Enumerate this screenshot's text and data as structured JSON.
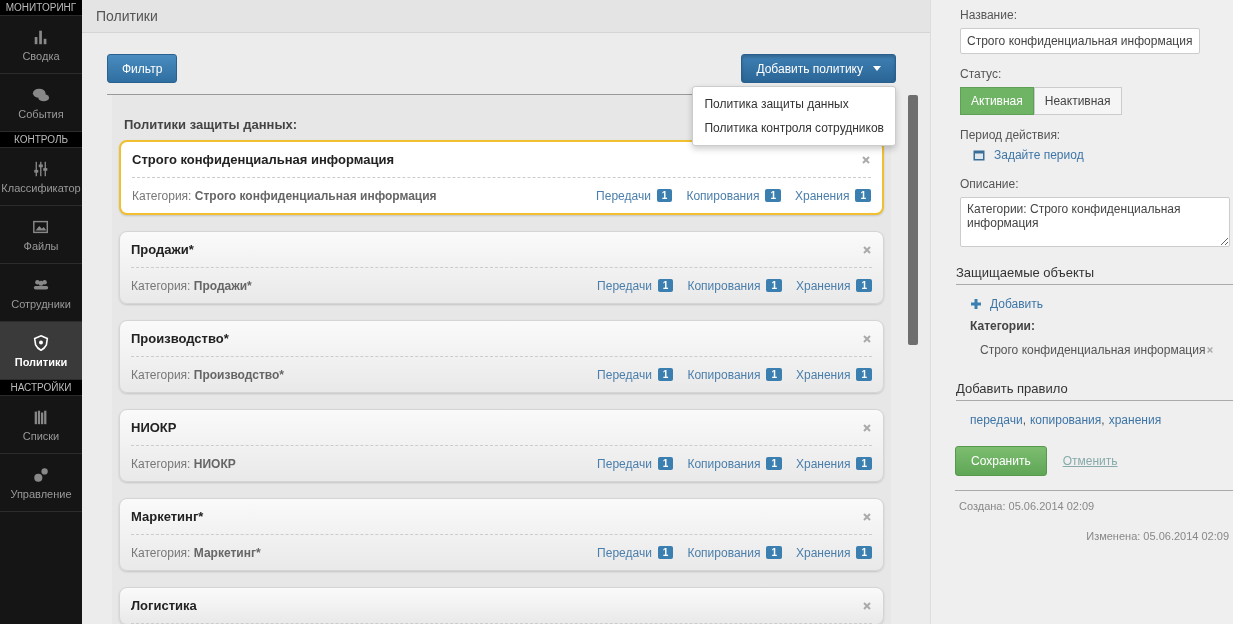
{
  "sidebar": {
    "sections": [
      {
        "title": "МОНИТОРИНГ",
        "items": [
          {
            "label": "Сводка",
            "selected": false
          },
          {
            "label": "События",
            "selected": false
          }
        ]
      },
      {
        "title": "КОНТРОЛЬ",
        "items": [
          {
            "label": "Классификатор",
            "selected": false
          },
          {
            "label": "Файлы",
            "selected": false
          },
          {
            "label": "Сотрудники",
            "selected": false
          },
          {
            "label": "Политики",
            "selected": true
          }
        ]
      },
      {
        "title": "НАСТРОЙКИ",
        "items": [
          {
            "label": "Списки",
            "selected": false
          },
          {
            "label": "Управление",
            "selected": false
          }
        ]
      }
    ]
  },
  "page_title": "Политики",
  "toolbar": {
    "filter_button": "Фильтр",
    "add_button": "Добавить политику",
    "menu": {
      "expanded": true,
      "items": [
        "Политика защиты данных",
        "Политика контроля сотрудников"
      ]
    }
  },
  "section_title": "Политики защиты данных:",
  "policies": [
    {
      "name": "Строго конфиденциальная информация",
      "selected": true,
      "category_label": "Категория:",
      "category": "Строго конфиденциальная информация",
      "rules": [
        {
          "label": "Передачи",
          "count": "1"
        },
        {
          "label": "Копирования",
          "count": "1"
        },
        {
          "label": "Хранения",
          "count": "1"
        }
      ]
    },
    {
      "name": "Продажи*",
      "selected": false,
      "category_label": "Категория:",
      "category": "Продажи*",
      "rules": [
        {
          "label": "Передачи",
          "count": "1"
        },
        {
          "label": "Копирования",
          "count": "1"
        },
        {
          "label": "Хранения",
          "count": "1"
        }
      ]
    },
    {
      "name": "Производство*",
      "selected": false,
      "category_label": "Категория:",
      "category": "Производство*",
      "rules": [
        {
          "label": "Передачи",
          "count": "1"
        },
        {
          "label": "Копирования",
          "count": "1"
        },
        {
          "label": "Хранения",
          "count": "1"
        }
      ]
    },
    {
      "name": "НИОКР",
      "selected": false,
      "category_label": "Категория:",
      "category": "НИОКР",
      "rules": [
        {
          "label": "Передачи",
          "count": "1"
        },
        {
          "label": "Копирования",
          "count": "1"
        },
        {
          "label": "Хранения",
          "count": "1"
        }
      ]
    },
    {
      "name": "Маркетинг*",
      "selected": false,
      "category_label": "Категория:",
      "category": "Маркетинг*",
      "rules": [
        {
          "label": "Передачи",
          "count": "1"
        },
        {
          "label": "Копирования",
          "count": "1"
        },
        {
          "label": "Хранения",
          "count": "1"
        }
      ]
    },
    {
      "name": "Логистика",
      "selected": false
    }
  ],
  "details": {
    "name_label": "Название:",
    "name_value": "Строго конфиденциальная информация",
    "status_label": "Статус:",
    "status_options": [
      {
        "label": "Активная",
        "selected": true
      },
      {
        "label": "Неактивная",
        "selected": false
      }
    ],
    "period_label": "Период действия:",
    "period_link": "Задайте период",
    "description_label": "Описание:",
    "description_value": "Категории: Строго конфиденциальная информация",
    "protected_title": "Защищаемые объекты",
    "add_link": "Добавить",
    "categories_label": "Категории:",
    "categories": [
      "Строго конфиденциальная информация"
    ],
    "rule_title": "Добавить правило",
    "rule_links": [
      {
        "label": "передачи",
        "separator": ","
      },
      {
        "label": "копирования",
        "separator": ","
      },
      {
        "label": "хранения"
      }
    ],
    "save_button": "Сохранить",
    "cancel_link": "Отменить",
    "created": "Создана: 05.06.2014 02:09",
    "modified": "Изменена: 05.06.2014 02:09"
  }
}
